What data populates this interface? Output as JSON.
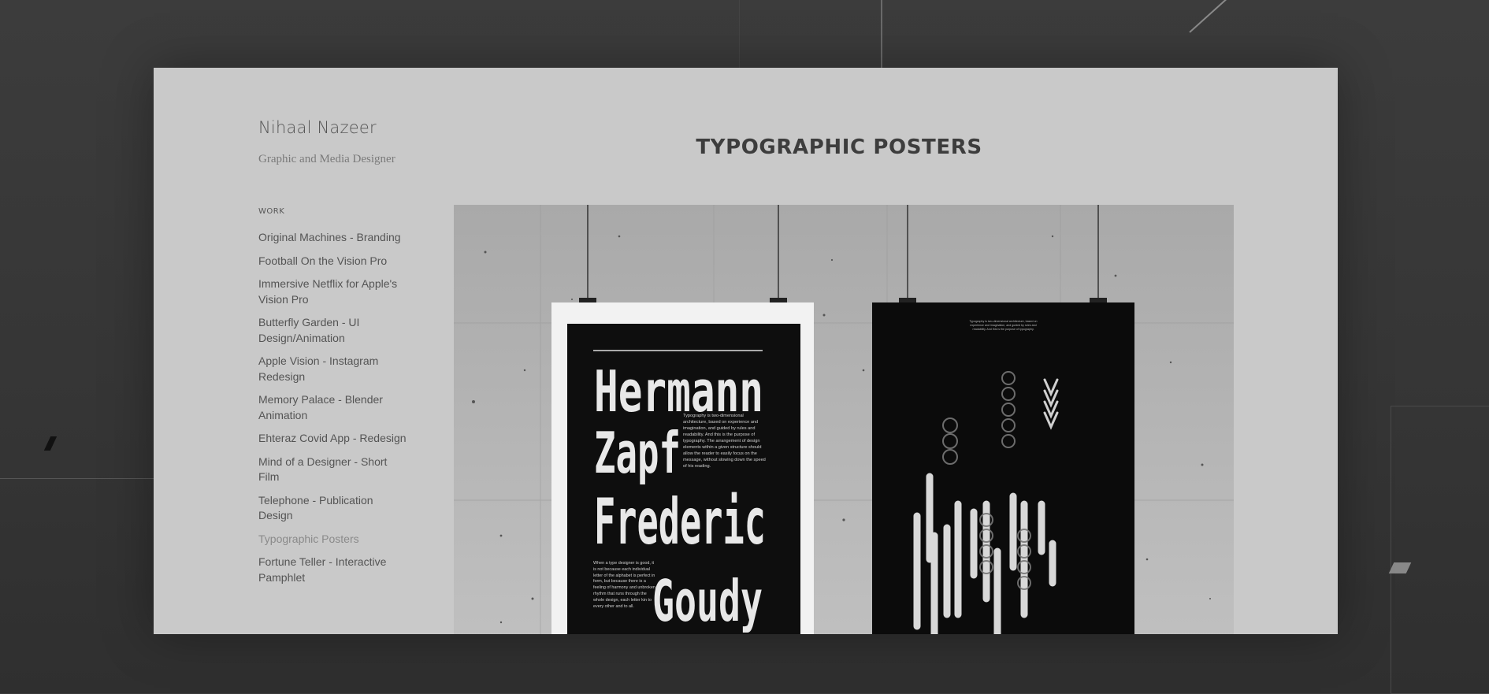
{
  "site": {
    "title": "Nihaal Nazeer",
    "subtitle": "Graphic and Media Designer"
  },
  "nav": {
    "heading": "WORK",
    "items": [
      {
        "label": "Original Machines - Branding",
        "active": false
      },
      {
        "label": "Football On the Vision Pro",
        "active": false
      },
      {
        "label": "Immersive Netflix for Apple's Vision Pro",
        "active": false
      },
      {
        "label": "Butterfly Garden - UI Design/Animation",
        "active": false
      },
      {
        "label": "Apple Vision - Instagram Redesign",
        "active": false
      },
      {
        "label": "Memory Palace - Blender Animation",
        "active": false
      },
      {
        "label": "Ehteraz Covid App - Redesign",
        "active": false
      },
      {
        "label": "Mind of a Designer - Short Film",
        "active": false
      },
      {
        "label": "Telephone - Publication Design",
        "active": false
      },
      {
        "label": "Typographic Posters",
        "active": true
      },
      {
        "label": "Fortune Teller - Interactive Pamphlet",
        "active": false
      }
    ]
  },
  "page": {
    "title": "TYPOGRAPHIC POSTERS"
  },
  "poster_left": {
    "lines": [
      "Hermann",
      "Zapf",
      "Frederic",
      "Goudy"
    ],
    "body_top": "Typography is two-dimensional architecture, based on experience and imagination, and guided by rules and readability. And this is the purpose of typography. The arrangement of design elements within a given structure should allow the reader to easily focus on the message, without slowing down the speed of his reading.",
    "body_bottom": "When a type designer is good, it is not because each individual letter of the alphabet is perfect in form, but because there is a feeling of harmony and unbroken rhythm that runs through the whole design, each letter kin to every other and to all."
  },
  "poster_right": {
    "caption": "Typography is two-dimensional architecture, based on experience and imagination, and guided by rules and readability. And this is the purpose of typography."
  },
  "colors": {
    "page_bg": "#c9c9c9",
    "text": "#545454",
    "active_nav": "#8a8a8a",
    "poster_bg": "#0e0e0e"
  }
}
